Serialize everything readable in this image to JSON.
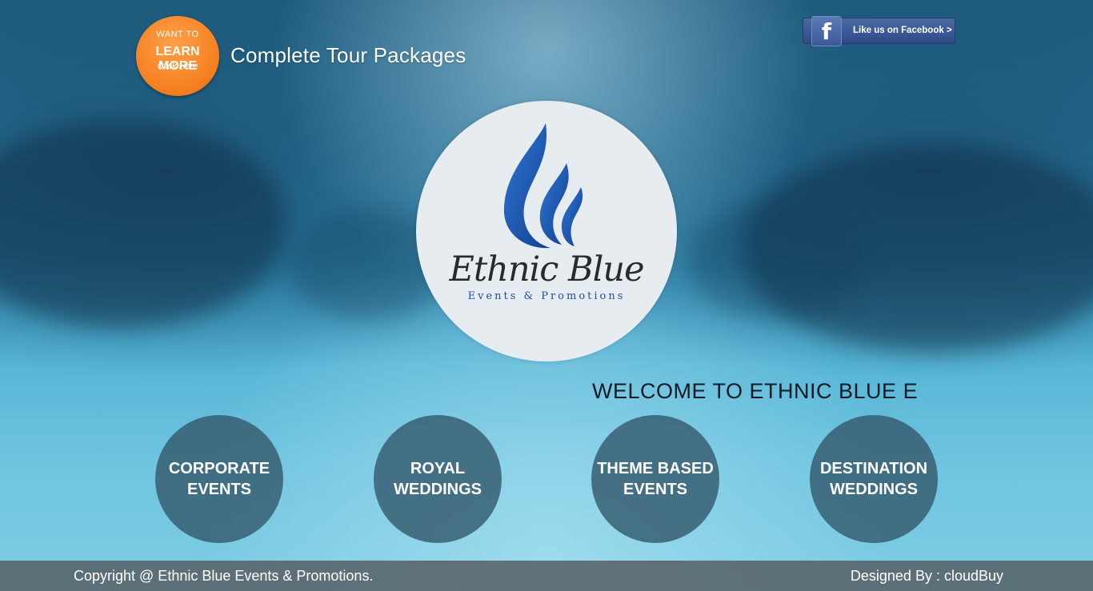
{
  "header": {
    "learn_badge": {
      "line1": "WANT TO",
      "line2": "LEARN MORE",
      "line3": "Click Here"
    },
    "title": "Complete Tour Packages",
    "facebook": {
      "icon": "f",
      "label": "Like us on Facebook >"
    }
  },
  "logo": {
    "brand_name": "Ethnic Blue",
    "brand_tagline": "Events & Promotions",
    "flame_color": "#1f5fb8"
  },
  "welcome_text": "WELCOME TO ETHNIC BLUE E",
  "services": [
    {
      "label": "CORPORATE EVENTS"
    },
    {
      "label": "ROYAL WEDDINGS"
    },
    {
      "label": "THEME BASED EVENTS"
    },
    {
      "label": "DESTINATION WEDDINGS"
    }
  ],
  "footer": {
    "copyright": "Copyright @ Ethnic Blue Events & Promotions.",
    "designed_by": "Designed By : cloudBuy"
  },
  "colors": {
    "badge_orange": "#f47e1e",
    "facebook_blue": "#3b5998",
    "service_circle": "#345a6e",
    "footer_bg": "#555f64"
  }
}
